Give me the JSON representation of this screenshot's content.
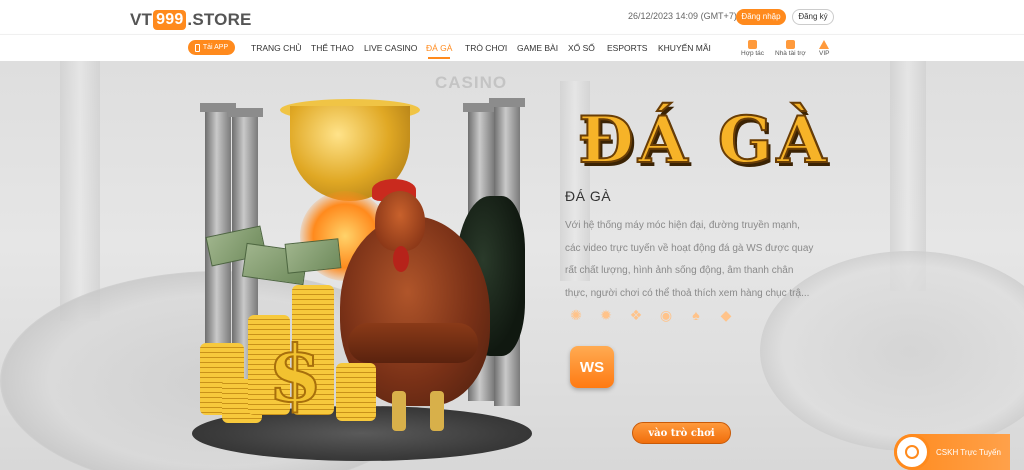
{
  "header": {
    "logo": {
      "prefix": "VT",
      "number": "999",
      "suffix": ".STORE"
    },
    "datetime": "26/12/2023 14:09   (GMT+7)",
    "login_label": "Đăng nhập",
    "register_label": "Đăng ký"
  },
  "nav": {
    "app_label": "Tải APP",
    "items": [
      {
        "label": "TRANG CHỦ"
      },
      {
        "label": "THỂ THAO"
      },
      {
        "label": "LIVE CASINO"
      },
      {
        "label": "ĐÁ GÀ"
      },
      {
        "label": "TRÒ CHƠI"
      },
      {
        "label": "GAME BÀI"
      },
      {
        "label": "XỔ SỐ"
      },
      {
        "label": "ESPORTS"
      },
      {
        "label": "KHUYẾN MÃI"
      }
    ],
    "active_index": 3,
    "side_links": [
      {
        "label": "Hợp tác",
        "icon": "partner-icon"
      },
      {
        "label": "Nhà tài trợ",
        "icon": "sponsor-icon"
      },
      {
        "label": "VIP",
        "icon": "crown-icon"
      }
    ]
  },
  "hero": {
    "background_sign": "CASINO",
    "title": "ĐÁ GÀ",
    "subtitle": "ĐÁ GÀ",
    "description": "Với hệ thống máy móc hiện đại, đường truyền mạnh, các video trực tuyến về hoạt động đá gà WS được quay rất chất lượng, hình ảnh sống động, âm thanh chân thực, người chơi có thể thoả thích xem hàng chục trậ...",
    "provider_logo": "WS",
    "play_label": "vào trò chơi",
    "dollar_sign": "$"
  },
  "support": {
    "label": "CSKH Trực Tuyến"
  },
  "colors": {
    "accent": "#ff8a1d",
    "title_gold": "#f6b328"
  }
}
